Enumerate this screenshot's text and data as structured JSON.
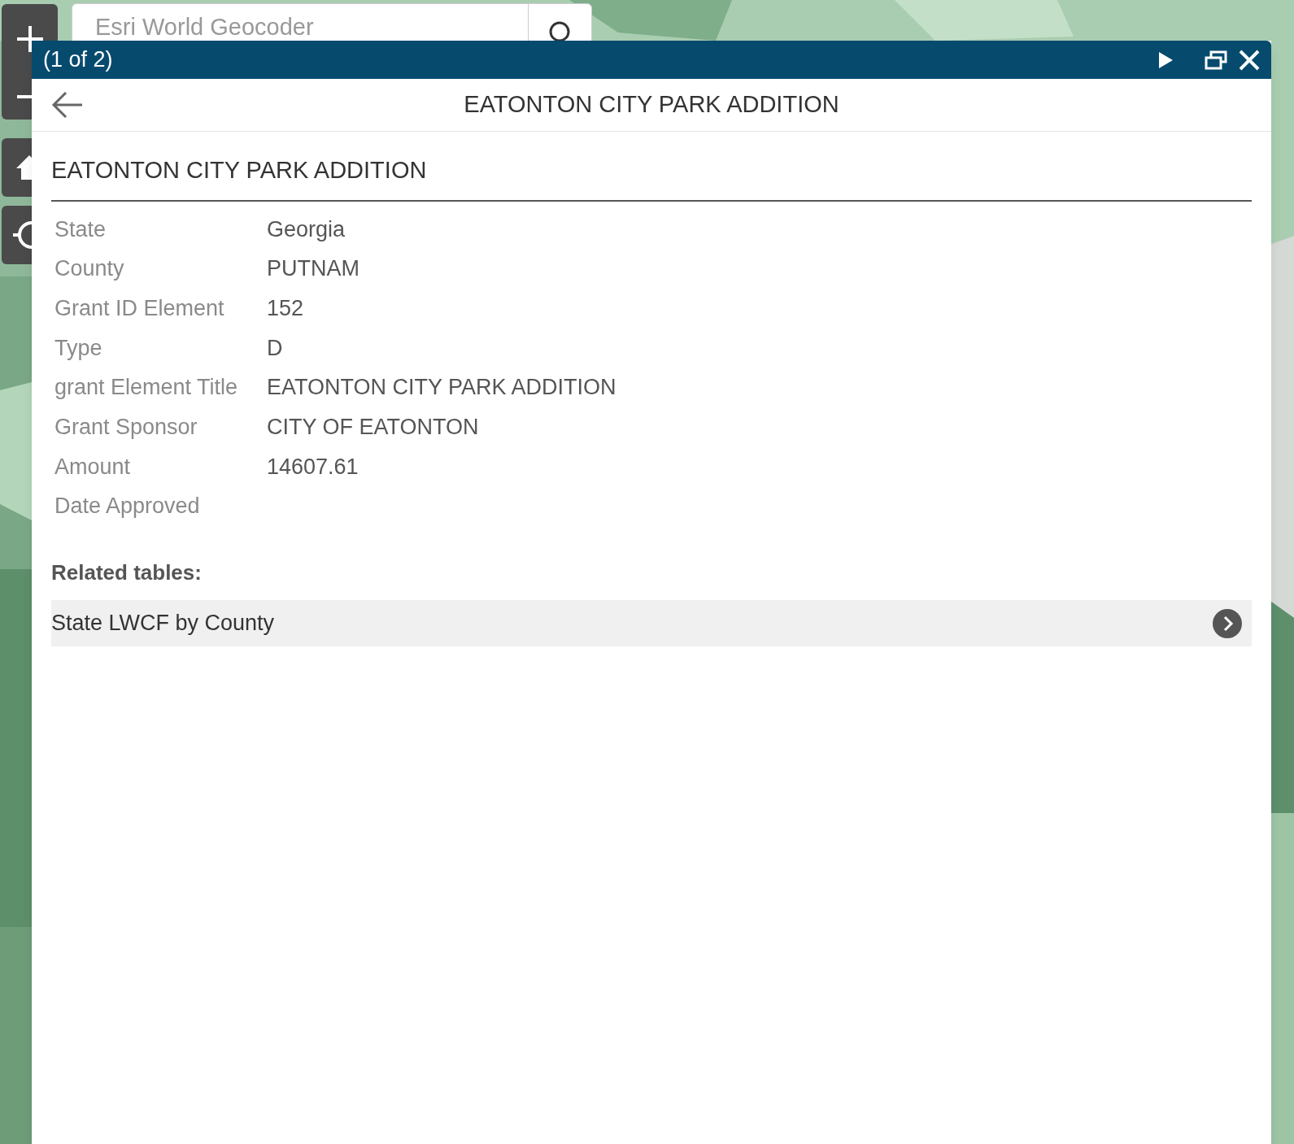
{
  "search": {
    "placeholder": "Esri World Geocoder"
  },
  "popup": {
    "counter": "(1 of 2)",
    "title": "EATONTON CITY PARK ADDITION",
    "heading": "EATONTON CITY PARK ADDITION",
    "fields": [
      {
        "label": "State",
        "value": "Georgia"
      },
      {
        "label": "County",
        "value": "PUTNAM"
      },
      {
        "label": "Grant ID Element",
        "value": "152"
      },
      {
        "label": "Type",
        "value": "D"
      },
      {
        "label": "grant Element Title",
        "value": "EATONTON CITY PARK ADDITION"
      },
      {
        "label": "Grant Sponsor",
        "value": "CITY OF EATONTON"
      },
      {
        "label": "Amount",
        "value": "14607.61"
      },
      {
        "label": "Date Approved"
      }
    ],
    "related_heading": "Related tables:",
    "related": [
      {
        "label": "State LWCF by County"
      }
    ]
  }
}
